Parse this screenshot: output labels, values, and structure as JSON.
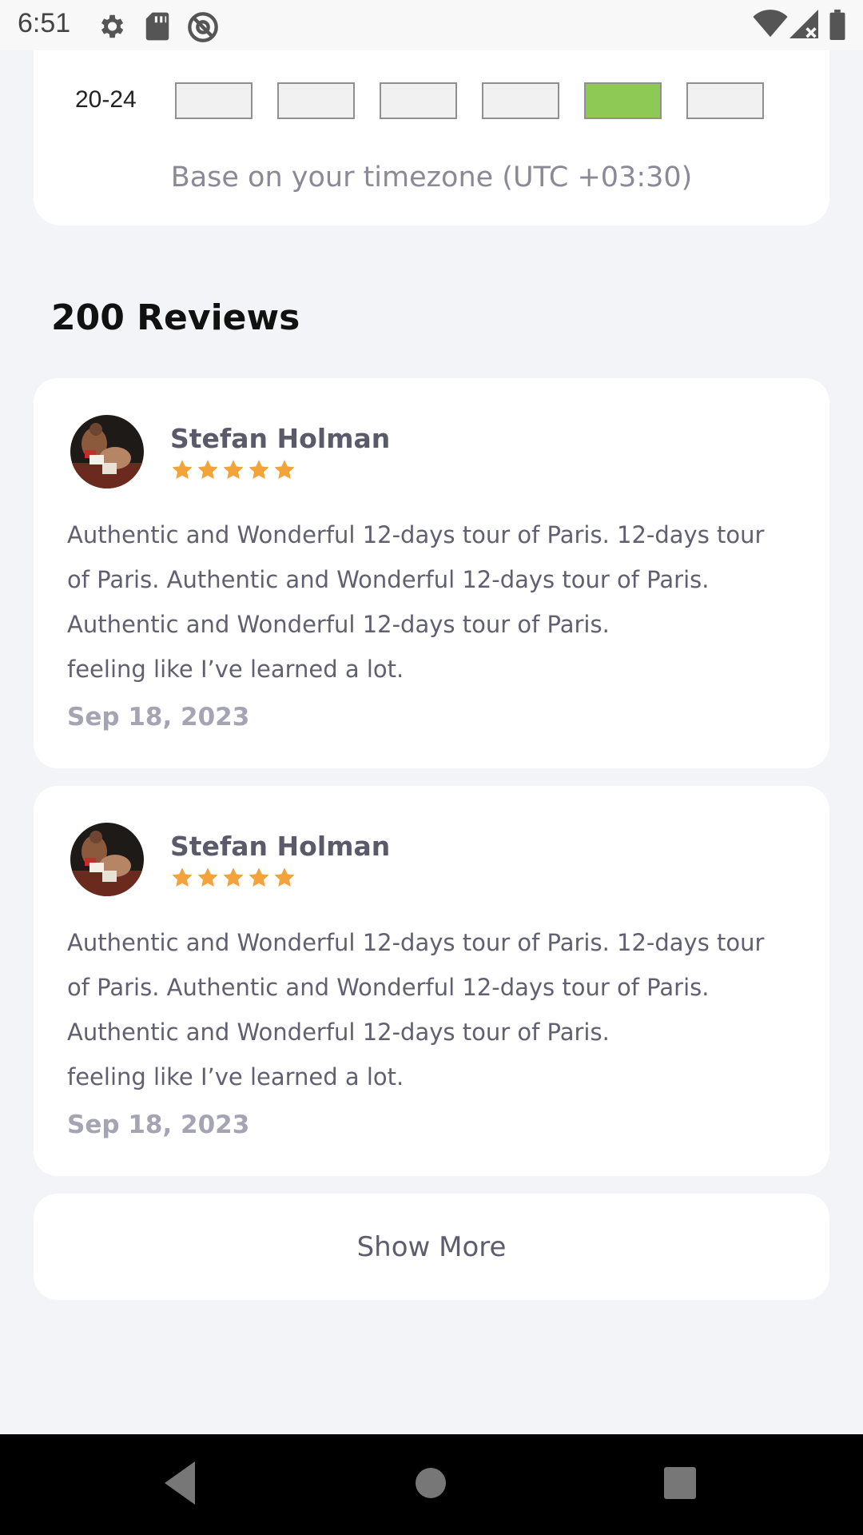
{
  "status_bar": {
    "time": "6:51",
    "icons": [
      "gear-icon",
      "sd-card-icon",
      "at-sign-icon",
      "wifi-icon",
      "signal-icon",
      "battery-icon"
    ]
  },
  "availability": {
    "row_label": "20-24",
    "slots_selected": [
      false,
      false,
      false,
      false,
      true,
      false
    ],
    "timezone_note": "Base on your timezone (UTC +03:30)",
    "active_color": "#8fc955"
  },
  "reviews": {
    "title": "200 Reviews",
    "items": [
      {
        "name": "Stefan Holman",
        "rating": 5,
        "text_lines": [
          "Authentic and Wonderful 12-days tour of Paris. 12-days tour",
          "of Paris. Authentic and Wonderful 12-days tour of Paris.",
          "Authentic and Wonderful 12-days tour of Paris.",
          "feeling like I’ve learned a lot."
        ],
        "date": "Sep 18, 2023"
      },
      {
        "name": "Stefan Holman",
        "rating": 5,
        "text_lines": [
          "Authentic and Wonderful 12-days tour of Paris. 12-days tour",
          "of Paris. Authentic and Wonderful 12-days tour of Paris.",
          "Authentic and Wonderful 12-days tour of Paris.",
          "feeling like I’ve learned a lot."
        ],
        "date": "Sep 18, 2023"
      }
    ],
    "show_more_label": "Show More",
    "star_color": "#f2a33a"
  },
  "nav_bar": {
    "buttons": [
      "back-icon",
      "home-icon",
      "recents-icon"
    ]
  }
}
